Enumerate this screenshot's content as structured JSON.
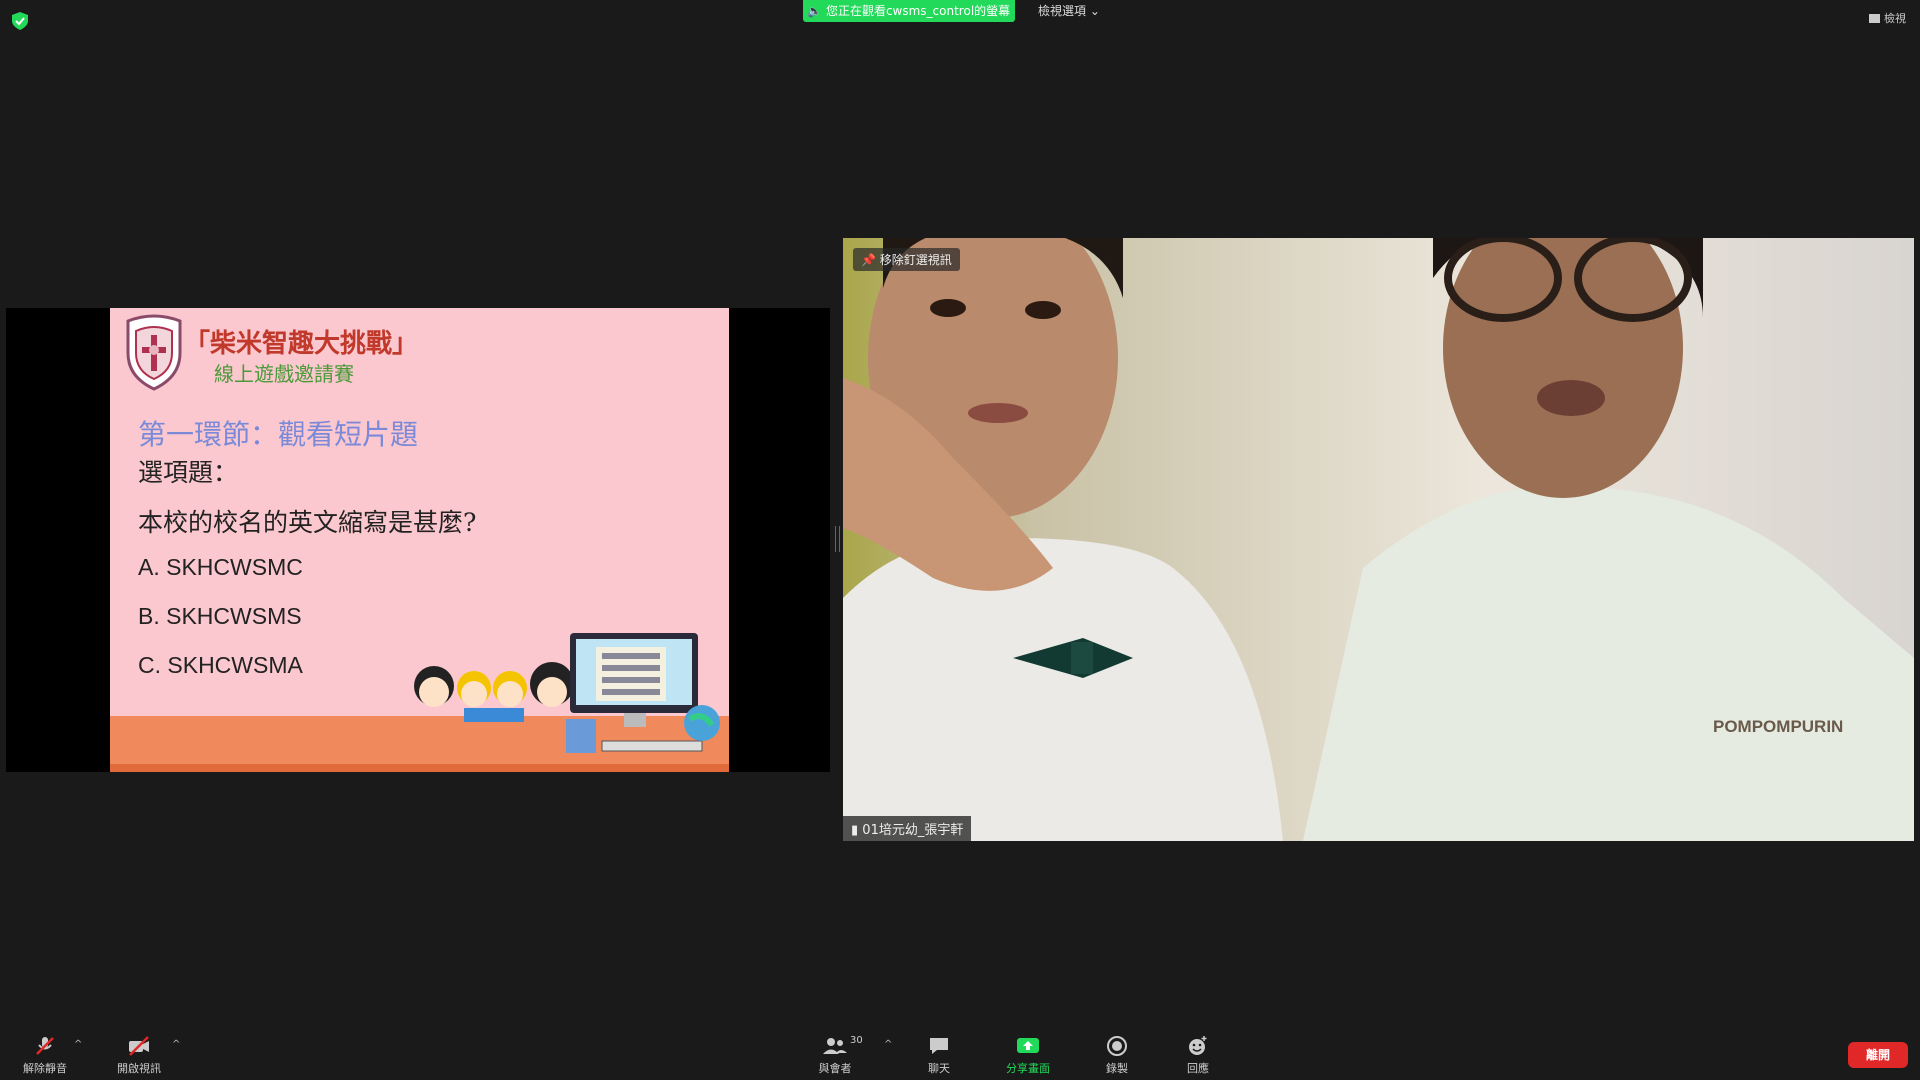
{
  "topbar": {
    "banner_text": "您正在觀看cwsms_control的螢幕",
    "view_options_label": "檢視選項",
    "view_button_label": "檢視"
  },
  "slide": {
    "title": "「柴米智趣大挑戰」",
    "subtitle": "線上遊戲邀請賽",
    "section": "第一環節：觀看短片題",
    "question_type": "選項題：",
    "question": "本校的校名的英文縮寫是甚麼?",
    "options": [
      "A. SKHCWSMC",
      "B. SKHCWSMS",
      "C. SKHCWSMA"
    ]
  },
  "video": {
    "pin_label": "移除釘選視訊",
    "participant_name": "01培元幼_張宇軒"
  },
  "toolbar": {
    "mute_label": "解除靜音",
    "video_label": "開啟視訊",
    "participants_label": "與會者",
    "participants_count": "30",
    "chat_label": "聊天",
    "share_label": "分享畫面",
    "record_label": "錄製",
    "reactions_label": "回應",
    "leave_label": "離開"
  },
  "colors": {
    "background": "#1a1a1a",
    "banner_green": "#23d959",
    "share_green": "#23d959",
    "leave_red": "#e02828",
    "slide_pink": "#fcc8cf"
  }
}
